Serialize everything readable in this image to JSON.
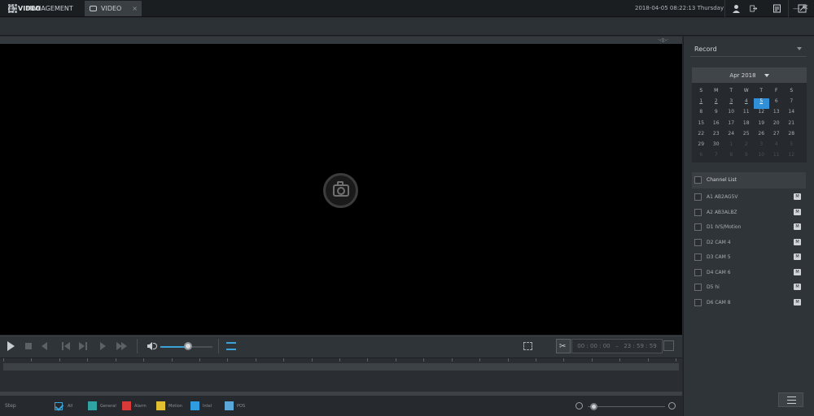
{
  "topbar": {
    "tabs": [
      {
        "label": "MANAGEMENT",
        "icon": "grid-icon"
      },
      {
        "label": "VIDEO",
        "icon": "video-icon",
        "close": "×"
      }
    ],
    "datetime": "2018-04-05 08:22:13 Thursday",
    "icons": [
      "user-icon",
      "logout-icon",
      "notes-icon",
      "settings-icon"
    ]
  },
  "window": {
    "title": "VIDEO",
    "min": "—",
    "close": "✕"
  },
  "video": {
    "strip_tag": "·◁▷·"
  },
  "controls": {
    "volume_level": 0.53,
    "start_time": "00 : 00 : 00",
    "time_separator": "–",
    "end_time": "23 : 59 : 59"
  },
  "legend": {
    "step_label": "Step",
    "items": [
      {
        "label": "All",
        "color": "#3aa3d8",
        "checked": true
      },
      {
        "label": "General",
        "color": "#2fa3a3"
      },
      {
        "label": "Alarm",
        "color": "#d83a3a"
      },
      {
        "label": "Motion",
        "color": "#e0c030"
      },
      {
        "label": "Intel",
        "color": "#2f9be0"
      },
      {
        "label": "POS",
        "color": "#5aa8d8"
      }
    ]
  },
  "sidebar": {
    "record_label": "Record",
    "calendar": {
      "month": "Apr 2018",
      "weekdays": [
        "S",
        "M",
        "T",
        "W",
        "T",
        "F",
        "S"
      ],
      "selected": "5",
      "days_with_record": [
        "1",
        "2",
        "3",
        "4",
        "5"
      ],
      "rows": [
        [
          "1",
          "2",
          "3",
          "4",
          "5",
          "6",
          "7"
        ],
        [
          "8",
          "9",
          "10",
          "11",
          "12",
          "13",
          "14"
        ],
        [
          "15",
          "16",
          "17",
          "18",
          "19",
          "20",
          "21"
        ],
        [
          "22",
          "23",
          "24",
          "25",
          "26",
          "27",
          "28"
        ],
        [
          "29",
          "30",
          "1",
          "2",
          "3",
          "4",
          "5"
        ],
        [
          "6",
          "7",
          "8",
          "9",
          "10",
          "11",
          "12"
        ]
      ]
    },
    "channel_list_label": "Channel List",
    "channels": [
      "A1 AB2AG5V",
      "A2 AB3ALBZ",
      "D1 IVS/Motion",
      "D2 CAM 4",
      "D3 CAM 5",
      "D4 CAM 6",
      "D5 hi",
      "D6 CAM 8"
    ],
    "channel_badge": "M"
  }
}
